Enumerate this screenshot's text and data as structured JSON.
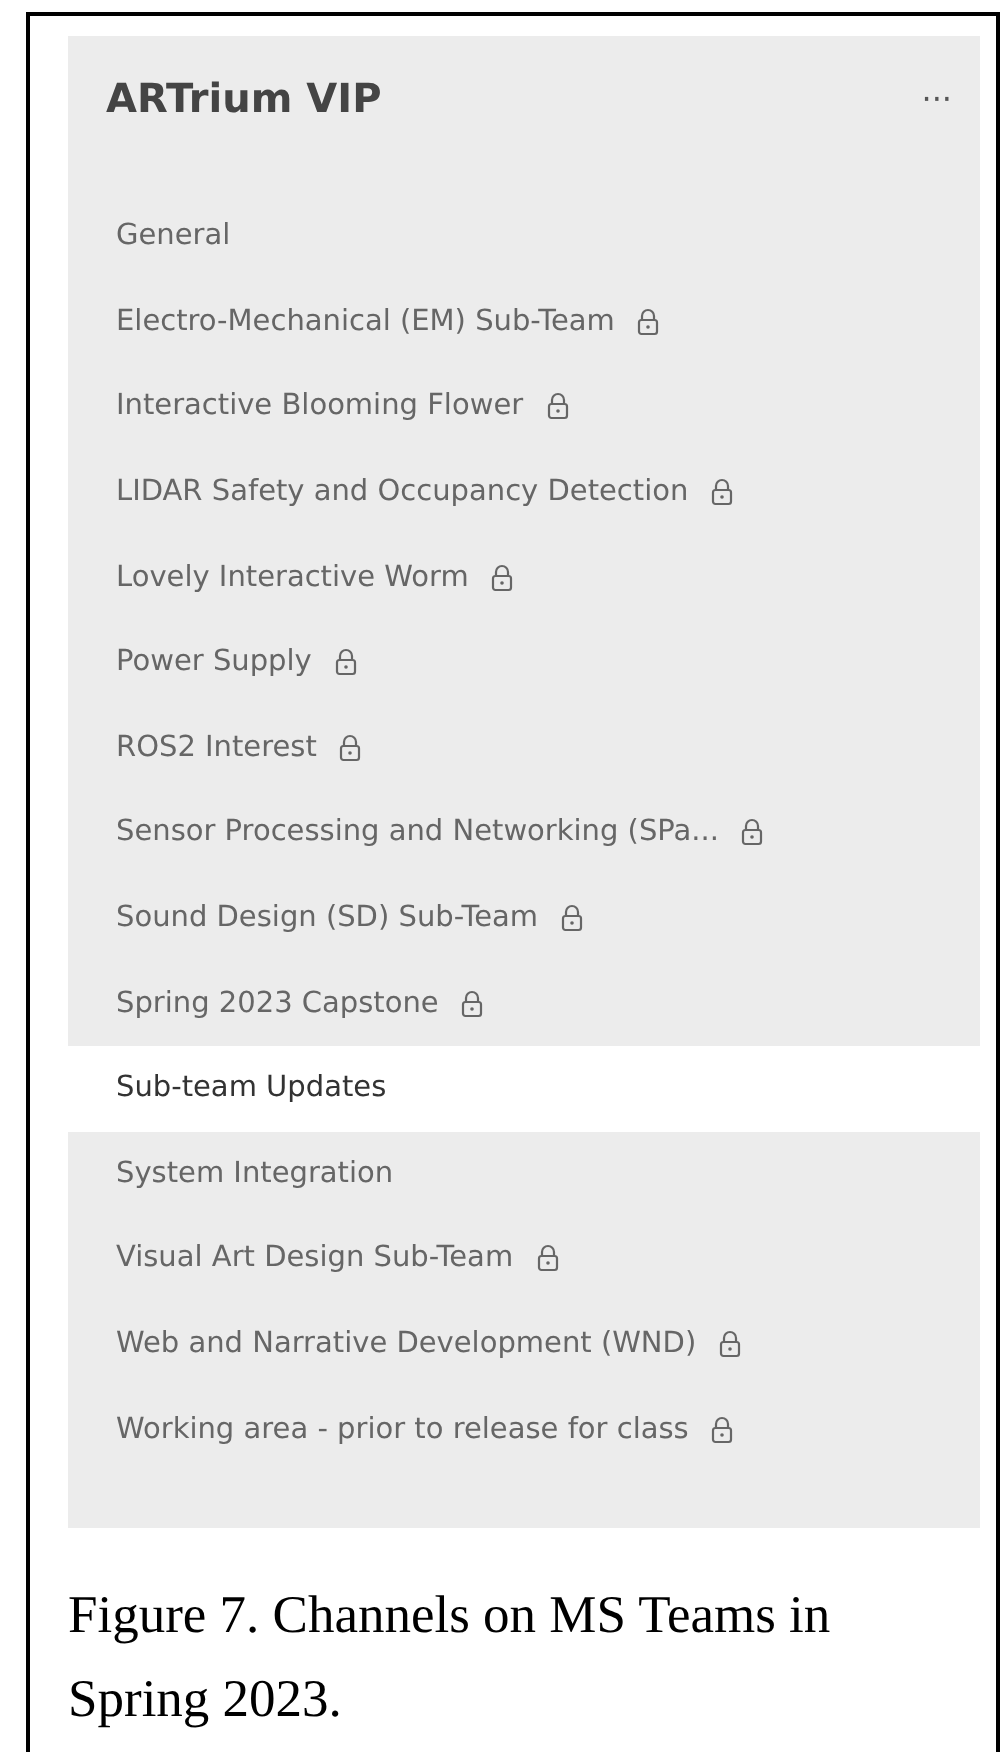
{
  "team": {
    "title": "ARTrium VIP",
    "more": "···"
  },
  "channels": [
    {
      "name": "General",
      "private": false,
      "selected": false
    },
    {
      "name": "Electro-Mechanical (EM) Sub-Team",
      "private": true,
      "selected": false
    },
    {
      "name": "Interactive Blooming Flower",
      "private": true,
      "selected": false
    },
    {
      "name": "LIDAR Safety and Occupancy Detection",
      "private": true,
      "selected": false
    },
    {
      "name": "Lovely Interactive Worm",
      "private": true,
      "selected": false
    },
    {
      "name": "Power Supply",
      "private": true,
      "selected": false
    },
    {
      "name": "ROS2 Interest",
      "private": true,
      "selected": false
    },
    {
      "name": "Sensor Processing and Networking (SPa...",
      "private": true,
      "selected": false
    },
    {
      "name": "Sound Design (SD) Sub-Team",
      "private": true,
      "selected": false
    },
    {
      "name": "Spring 2023 Capstone",
      "private": true,
      "selected": false
    },
    {
      "name": "Sub-team Updates",
      "private": false,
      "selected": true
    },
    {
      "name": "System Integration",
      "private": false,
      "selected": false
    },
    {
      "name": "Visual Art Design Sub-Team",
      "private": true,
      "selected": false
    },
    {
      "name": "Web and Narrative Development (WND)",
      "private": true,
      "selected": false
    },
    {
      "name": "Working area - prior to release for class",
      "private": true,
      "selected": false
    }
  ],
  "caption": "Figure 7. Channels on MS Teams in Spring 2023."
}
